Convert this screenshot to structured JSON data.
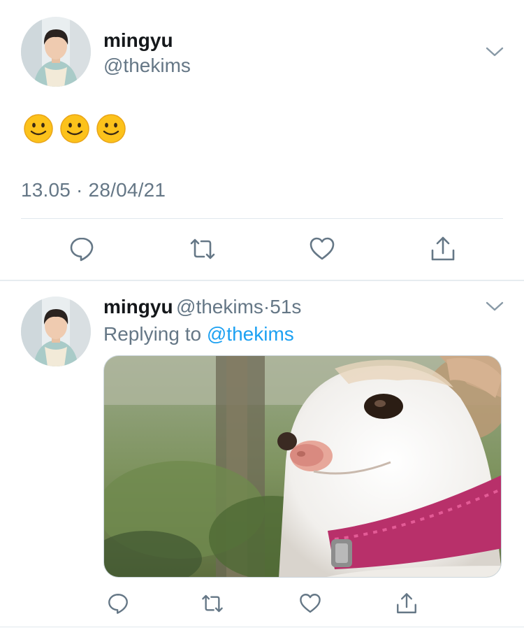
{
  "main_tweet": {
    "author_name": "mingyu",
    "author_handle": "@thekims",
    "content_emojis": [
      "slightly-smiling-face",
      "slightly-smiling-face",
      "slightly-smiling-face"
    ],
    "timestamp": "13.05 · 28/04/21",
    "actions": [
      "reply-icon",
      "retweet-icon",
      "like-icon",
      "share-icon"
    ]
  },
  "reply_tweet": {
    "author_name": "mingyu",
    "author_handle": "@thekims",
    "separator": "·",
    "time_ago": "51s",
    "replying_prefix": "Replying to",
    "replying_to": "@thekims",
    "media_description": "chihuahua-photo",
    "actions": [
      "reply-icon",
      "retweet-icon",
      "like-icon",
      "share-icon"
    ]
  },
  "colors": {
    "text_primary": "#14171a",
    "text_secondary": "#657786",
    "link": "#1da1f2",
    "divider": "#e1e8ed",
    "icon": "#657786"
  }
}
